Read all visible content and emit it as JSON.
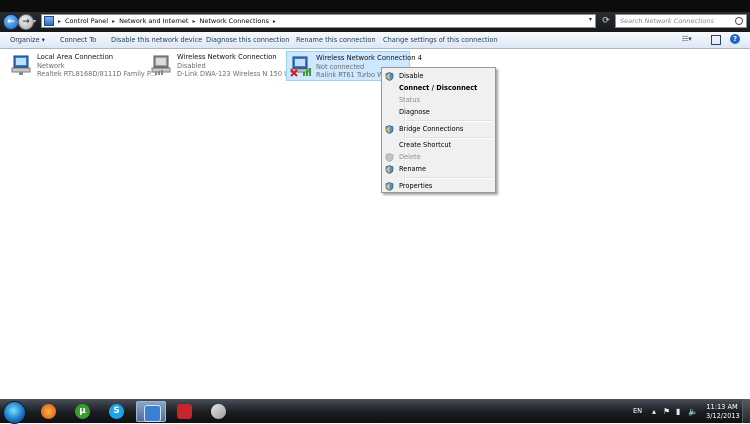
{
  "address": {
    "crumbs": [
      "Control Panel",
      "Network and Internet",
      "Network Connections"
    ],
    "search_placeholder": "Search Network Connections"
  },
  "commands": {
    "organize": "Organize ▾",
    "connect_to": "Connect To",
    "disable_device": "Disable this network device",
    "diagnose": "Diagnose this connection",
    "rename": "Rename this connection",
    "change_settings": "Change settings of this connection",
    "help": "?"
  },
  "connections": [
    {
      "name": "Local Area Connection",
      "status": "Network",
      "adapter": "Realtek RTL8168D/8111D Family P..."
    },
    {
      "name": "Wireless Network Connection",
      "status": "Disabled",
      "adapter": "D-Link DWA-123 Wireless N 150 U..."
    },
    {
      "name": "Wireless Network Connection 4",
      "status": "Not connected",
      "adapter": "Ralink RT61 Turbo W..."
    }
  ],
  "context_menu": {
    "disable": "Disable",
    "connect": "Connect / Disconnect",
    "status": "Status",
    "diagnose": "Diagnose",
    "bridge": "Bridge Connections",
    "shortcut": "Create Shortcut",
    "delete": "Delete",
    "rename": "Rename",
    "properties": "Properties"
  },
  "taskbar": {
    "language": "EN",
    "time": "11:13 AM",
    "date": "3/12/2013"
  },
  "colors": {
    "selection_fill": "#cde8ff",
    "command_text": "#1e395b",
    "taskbar": "#1a1c20"
  }
}
